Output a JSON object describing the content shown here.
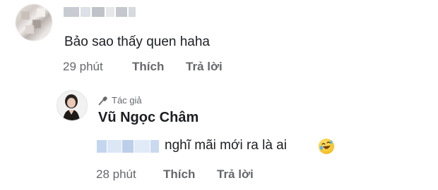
{
  "comment": {
    "text": "Bảo sao thấy quen haha",
    "time": "29 phút",
    "like_label": "Thích",
    "reply_label": "Trả lời"
  },
  "reply": {
    "badge": "Tác giả",
    "author": "Vũ Ngọc Châm",
    "text": "nghĩ mãi mới ra là ai",
    "emoji": "rolling-on-floor-laughing",
    "time": "28 phút",
    "like_label": "Thích",
    "reply_label": "Trả lời"
  },
  "colors": {
    "text": "#1c1e21",
    "meta": "#65676b"
  }
}
